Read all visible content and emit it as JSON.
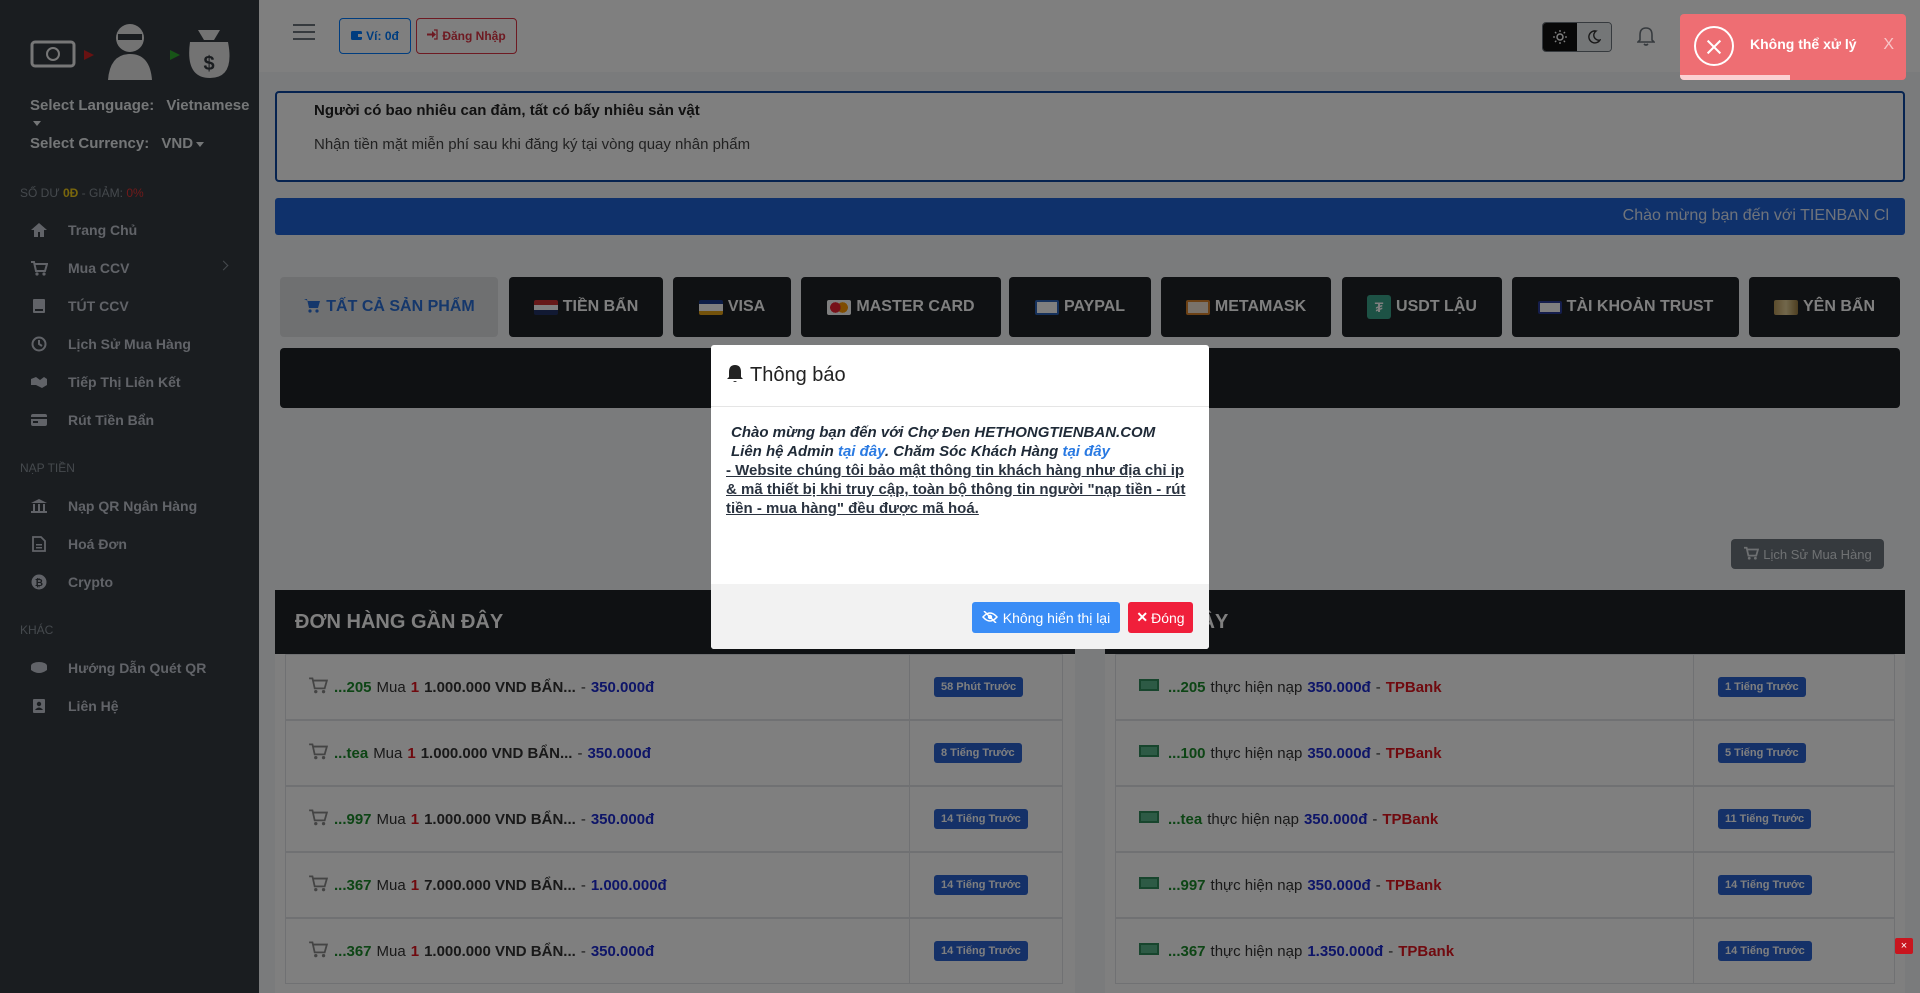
{
  "sidebar": {
    "lang_label": "Select Language:",
    "lang_value": "Vietnamese",
    "cur_label": "Select Currency:",
    "cur_value": "VND",
    "balance_label": "SỐ DƯ",
    "balance_value": "0Đ",
    "discount_label": "- GIẢM:",
    "discount_value": "0%",
    "items": [
      {
        "label": "Trang Chủ",
        "icon": "home-icon"
      },
      {
        "label": "Mua CCV",
        "icon": "cart-icon"
      },
      {
        "label": "TÚT CCV",
        "icon": "book-icon"
      },
      {
        "label": "Lịch Sử Mua Hàng",
        "icon": "history-icon"
      },
      {
        "label": "Tiếp Thị Liên Kết",
        "icon": "handshake-icon"
      },
      {
        "label": "Rút Tiền Bẩn",
        "icon": "card-icon"
      }
    ],
    "section_nap": "NẠP TIỀN",
    "items_nap": [
      {
        "label": "Nạp QR Ngân Hàng",
        "icon": "bank-icon"
      },
      {
        "label": "Hoá Đơn",
        "icon": "invoice-icon"
      },
      {
        "label": "Crypto",
        "icon": "bitcoin-icon"
      }
    ],
    "section_khac": "KHÁC",
    "items_khac": [
      {
        "label": "Hướng Dẫn Quét QR",
        "icon": "coin-icon"
      },
      {
        "label": "Liên Hệ",
        "icon": "contact-icon"
      }
    ]
  },
  "topbar": {
    "wallet": "Ví: 0đ",
    "login": "Đăng Nhập"
  },
  "toast": {
    "message": "Không thể xử lý",
    "close": "X"
  },
  "announce": {
    "line1": "Người có bao nhiêu can đảm, tất có bấy nhiêu sản vật",
    "line2": "Nhận tiền mặt miễn phí sau khi đăng ký tại vòng quay nhân phẩm"
  },
  "marquee": "Chào mừng bạn đến với TIENBAN Cl",
  "tabs": [
    "TẤT CẢ SẢN PHẨM",
    "TIỀN BẨN",
    "VISA",
    "MASTER CARD",
    "PAYPAL",
    "METAMASK",
    "USDT LẬU",
    "TÀI KHOẢN TRUST",
    "YÊN BẨN"
  ],
  "history_button": "Lịch Sử Mua Hàng",
  "orders": {
    "title": "ĐƠN HÀNG GẦN ĐÂY",
    "rows": [
      {
        "user": "...205",
        "verb": "Mua",
        "qty": "1",
        "item": "1.000.000 VND BẨN...",
        "sep": "-",
        "price": "350.000đ",
        "time": "58 Phút Trước"
      },
      {
        "user": "...tea",
        "verb": "Mua",
        "qty": "1",
        "item": "1.000.000 VND BẨN...",
        "sep": "-",
        "price": "350.000đ",
        "time": "8 Tiếng Trước"
      },
      {
        "user": "...997",
        "verb": "Mua",
        "qty": "1",
        "item": "1.000.000 VND BẨN...",
        "sep": "-",
        "price": "350.000đ",
        "time": "14 Tiếng Trước"
      },
      {
        "user": "...367",
        "verb": "Mua",
        "qty": "1",
        "item": "7.000.000 VND BẨN...",
        "sep": "-",
        "price": "1.000.000đ",
        "time": "14 Tiếng Trước"
      },
      {
        "user": "...367",
        "verb": "Mua",
        "qty": "1",
        "item": "1.000.000 VND BẨN...",
        "sep": "-",
        "price": "350.000đ",
        "time": "14 Tiếng Trước"
      }
    ]
  },
  "deposits": {
    "title": "I GẦN ĐÂY",
    "rows": [
      {
        "user": "...205",
        "verb": "thực hiện nạp",
        "amount": "350.000đ",
        "sep": "-",
        "bank": "TPBank",
        "time": "1 Tiếng Trước"
      },
      {
        "user": "...100",
        "verb": "thực hiện nạp",
        "amount": "350.000đ",
        "sep": "-",
        "bank": "TPBank",
        "time": "5 Tiếng Trước"
      },
      {
        "user": "...tea",
        "verb": "thực hiện nạp",
        "amount": "350.000đ",
        "sep": "-",
        "bank": "TPBank",
        "time": "11 Tiếng Trước"
      },
      {
        "user": "...997",
        "verb": "thực hiện nạp",
        "amount": "350.000đ",
        "sep": "-",
        "bank": "TPBank",
        "time": "14 Tiếng Trước"
      },
      {
        "user": "...367",
        "verb": "thực hiện nạp",
        "amount": "1.350.000đ",
        "sep": "-",
        "bank": "TPBank",
        "time": "14 Tiếng Trước"
      }
    ]
  },
  "modal": {
    "title": "Thông báo",
    "line1": "Chào mừng bạn đến với Chợ Đen HETHONGTIENBAN.COM",
    "line2a": "Liên hệ Admin ",
    "link1": "tại đây",
    "line2b": ". Chăm Sóc Khách Hàng ",
    "link2": "tại đây",
    "para": "- Website chúng tôi bảo mật thông tin khách hàng như địa chỉ ip & mã thiết bị khi truy cập, toàn bộ thông tin người \"nạp tiền - rút tiền - mua hàng\" đều được mã hoá.",
    "btn_hide": "Không hiển thị lại",
    "btn_close": "Đóng"
  },
  "corner_close": "×"
}
